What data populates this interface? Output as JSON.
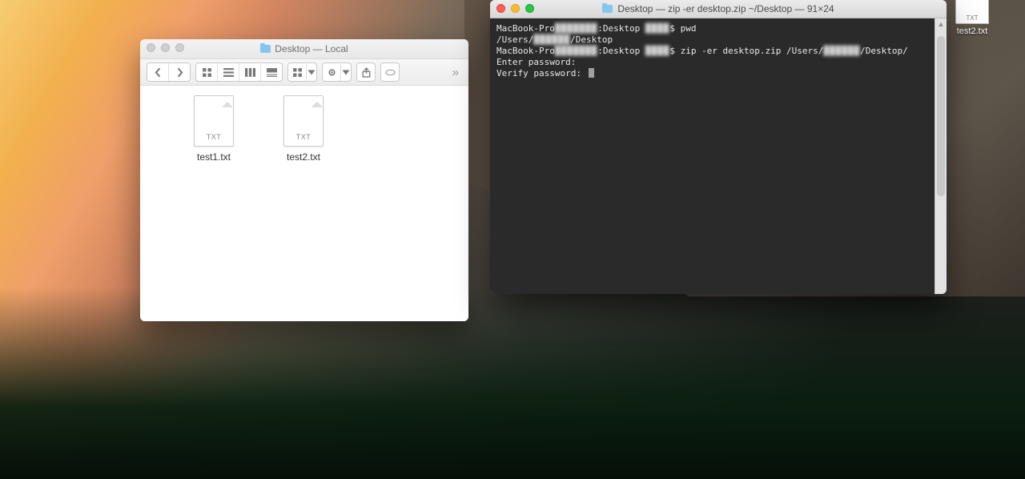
{
  "desktop_items": [
    {
      "label": "test2.txt",
      "ext": "TXT"
    }
  ],
  "finder": {
    "title": "Desktop — Local",
    "files": [
      {
        "label": "test1.txt",
        "ext": "TXT"
      },
      {
        "label": "test2.txt",
        "ext": "TXT"
      }
    ]
  },
  "terminal": {
    "title": "Desktop — zip -er desktop.zip ~/Desktop — 91×24",
    "lines": {
      "l0_pre": "MacBook-Pro",
      "l0_mid": ":Desktop ",
      "l0_end": "$ pwd",
      "l1_pre": "/Users/",
      "l1_end": "/Desktop",
      "l2_pre": "MacBook-Pro",
      "l2_mid": ":Desktop ",
      "l2_cmd": "$ zip -er desktop.zip /Users/",
      "l2_end": "/Desktop/",
      "l3": "Enter password:",
      "l4": "Verify password:"
    }
  }
}
